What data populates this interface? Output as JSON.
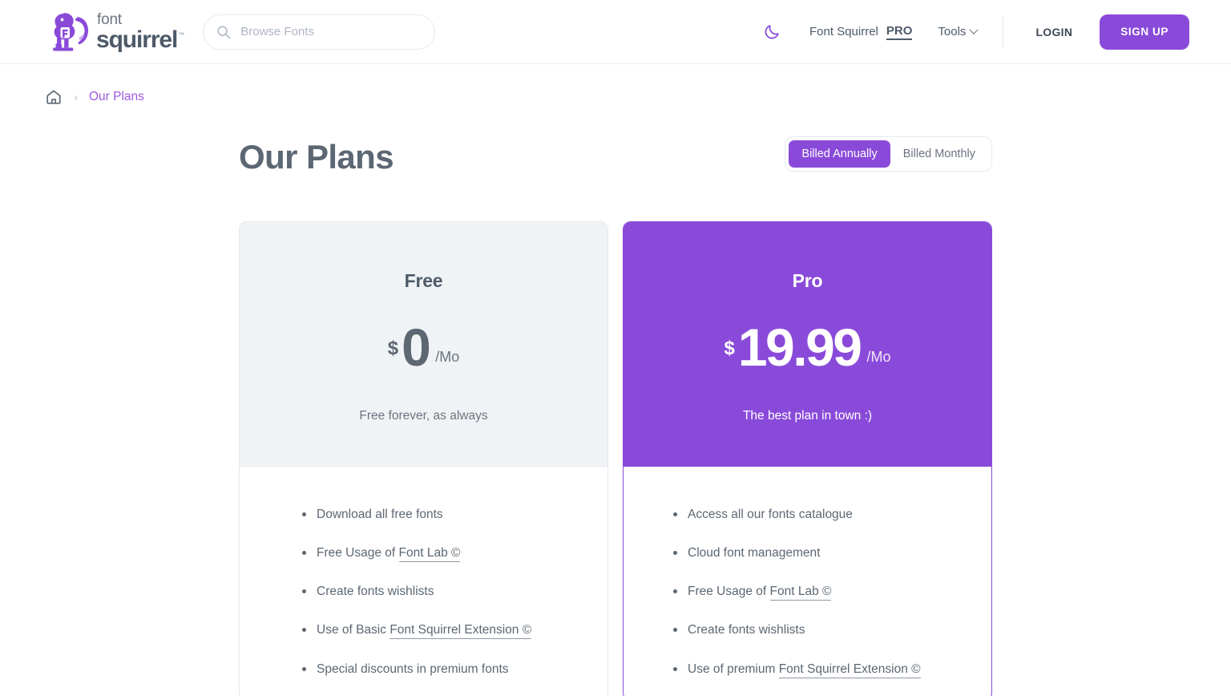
{
  "brand": {
    "line1": "font",
    "line2": "squirrel",
    "tm": "™",
    "logo_color": "#8a4ad9"
  },
  "search": {
    "placeholder": "Browse Fonts",
    "value": ""
  },
  "header": {
    "theme_toggle_icon": "moon-icon",
    "pro_link_prefix": "Font Squirrel",
    "pro_link_tag": "PRO",
    "tools_label": "Tools",
    "login_label": "LOGIN",
    "signup_label": "SIGN UP",
    "accent": "#8a4ad9"
  },
  "breadcrumb": {
    "home_icon": "home-icon",
    "separator": "›",
    "current": "Our Plans"
  },
  "main": {
    "title": "Our Plans",
    "billing": {
      "options": [
        "Billed Annually",
        "Billed Monthly"
      ],
      "selected": "Billed Annually"
    }
  },
  "plans": [
    {
      "name": "Free",
      "currency": "$",
      "amount": "0",
      "period": "/Mo",
      "tagline": "Free forever, as always",
      "features": [
        {
          "prefix": "Download all free fonts",
          "link": "",
          "suffix": ""
        },
        {
          "prefix": "Free Usage of ",
          "link": "Font Lab ©",
          "suffix": ""
        },
        {
          "prefix": "Create fonts wishlists",
          "link": "",
          "suffix": ""
        },
        {
          "prefix": "Use of Basic ",
          "link": "Font Squirrel Extension ©",
          "suffix": ""
        },
        {
          "prefix": "Special discounts in premium fonts",
          "link": "",
          "suffix": ""
        }
      ]
    },
    {
      "name": "Pro",
      "currency": "$",
      "amount": "19.99",
      "period": "/Mo",
      "tagline": "The best plan in town :)",
      "features": [
        {
          "prefix": "Access all our fonts catalogue",
          "link": "",
          "suffix": ""
        },
        {
          "prefix": "Cloud font management",
          "link": "",
          "suffix": ""
        },
        {
          "prefix": "Free Usage of ",
          "link": "Font Lab ©",
          "suffix": ""
        },
        {
          "prefix": "Create fonts wishlists",
          "link": "",
          "suffix": ""
        },
        {
          "prefix": "Use of premium ",
          "link": "Font Squirrel Extension ©",
          "suffix": ""
        }
      ]
    }
  ]
}
